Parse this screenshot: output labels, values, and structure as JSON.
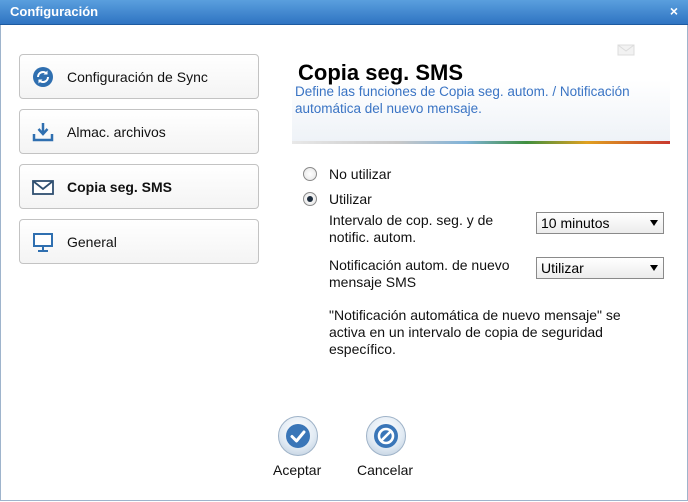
{
  "window": {
    "title": "Configuración",
    "close": "×"
  },
  "sidebar": {
    "items": [
      {
        "label": "Configuración de Sync",
        "icon": "sync-icon"
      },
      {
        "label": "Almac. archivos",
        "icon": "download-tray-icon"
      },
      {
        "label": "Copia seg. SMS",
        "icon": "envelope-icon",
        "active": true
      },
      {
        "label": "General",
        "icon": "monitor-icon"
      }
    ]
  },
  "panel": {
    "title": "Copia seg. SMS",
    "description": "Define las funciones de Copia seg. autom. / Notificación automática del nuevo mensaje."
  },
  "options": {
    "no_use_label": "No utilizar",
    "use_label": "Utilizar",
    "selected": "Utilizar",
    "interval_label": "Intervalo de cop. seg. y de notific. autom.",
    "interval_value": "10 minutos",
    "notif_label": "Notificación autom. de nuevo mensaje SMS",
    "notif_value": "Utilizar",
    "note": "\"Notificación automática de nuevo mensaje\" se activa en un intervalo de copia de seguridad específico."
  },
  "buttons": {
    "accept": "Aceptar",
    "cancel": "Cancelar"
  },
  "colors": {
    "titlebar": "#3a80cc",
    "accent_text": "#3a74c4",
    "icon_blue": "#2f6fb0"
  }
}
